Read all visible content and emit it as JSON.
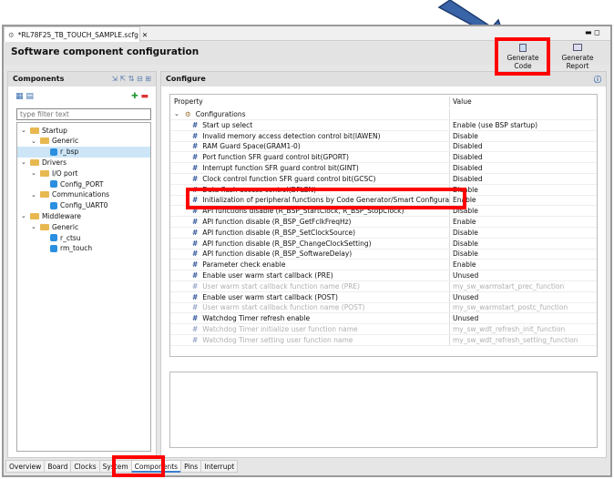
{
  "file_tab": {
    "label": "*RL78F25_TB_TOUCH_SAMPLE.scfg"
  },
  "header": {
    "title": "Software component configuration",
    "generate_code": "Generate Code",
    "generate_report": "Generate Report"
  },
  "components": {
    "title": "Components",
    "filter_placeholder": "type filter text",
    "tree": [
      {
        "label": "Startup",
        "level": 0,
        "type": "folder"
      },
      {
        "label": "Generic",
        "level": 1,
        "type": "folder"
      },
      {
        "label": "r_bsp",
        "level": 2,
        "type": "component",
        "selected": true
      },
      {
        "label": "Drivers",
        "level": 0,
        "type": "folder"
      },
      {
        "label": "I/O port",
        "level": 1,
        "type": "folder"
      },
      {
        "label": "Config_PORT",
        "level": 2,
        "type": "component"
      },
      {
        "label": "Communications",
        "level": 1,
        "type": "folder"
      },
      {
        "label": "Config_UART0",
        "level": 2,
        "type": "component"
      },
      {
        "label": "Middleware",
        "level": 0,
        "type": "folder"
      },
      {
        "label": "Generic",
        "level": 1,
        "type": "folder"
      },
      {
        "label": "r_ctsu",
        "level": 2,
        "type": "component"
      },
      {
        "label": "rm_touch",
        "level": 2,
        "type": "component"
      }
    ]
  },
  "configure": {
    "title": "Configure",
    "col_property": "Property",
    "col_value": "Value",
    "group": "Configurations",
    "rows": [
      {
        "p": "Start up select",
        "v": "Enable (use BSP startup)"
      },
      {
        "p": "Invalid memory access detection control bit(IAWEN)",
        "v": "Disable"
      },
      {
        "p": "RAM Guard Space(GRAM1-0)",
        "v": "Disabled"
      },
      {
        "p": "Port function SFR guard control bit(GPORT)",
        "v": "Disabled"
      },
      {
        "p": "Interrupt function SFR guard control bit(GINT)",
        "v": "Disabled"
      },
      {
        "p": "Clock control function SFR guard control bit(GCSC)",
        "v": "Disabled"
      },
      {
        "p": "Data flash access control(DFLEN)",
        "v": "Disable"
      },
      {
        "p": "Initialization of peripheral functions by Code Generator/Smart Configurator",
        "v": "Enable"
      },
      {
        "p": "API functions disable (R_BSP_StartClock, R_BSP_StopClock)",
        "v": "Disable"
      },
      {
        "p": "API function disable (R_BSP_GetFclkFreqHz)",
        "v": "Enable"
      },
      {
        "p": "API function disable (R_BSP_SetClockSource)",
        "v": "Disable"
      },
      {
        "p": "API function disable (R_BSP_ChangeClockSetting)",
        "v": "Disable"
      },
      {
        "p": "API function disable (R_BSP_SoftwareDelay)",
        "v": "Disable"
      },
      {
        "p": "Parameter check enable",
        "v": "Enable"
      },
      {
        "p": "Enable user warm start callback (PRE)",
        "v": "Unused"
      },
      {
        "p": "User warm start callback  function name (PRE)",
        "v": "my_sw_warmstart_prec_function",
        "disabled": true
      },
      {
        "p": "Enable user warm start callback (POST)",
        "v": "Unused"
      },
      {
        "p": "User warm start callback  function name (POST)",
        "v": "my_sw_warmstart_postc_function",
        "disabled": true
      },
      {
        "p": "Watchdog Timer refresh enable",
        "v": "Unused"
      },
      {
        "p": "Watchdog Timer initialize user function name",
        "v": "my_sw_wdt_refresh_init_function",
        "disabled": true
      },
      {
        "p": "Watchdog Timer setting user function name",
        "v": "my_sw_wdt_refresh_setting_function",
        "disabled": true
      }
    ]
  },
  "bottom_tabs": [
    {
      "label": "Overview"
    },
    {
      "label": "Board"
    },
    {
      "label": "Clocks"
    },
    {
      "label": "System"
    },
    {
      "label": "Components",
      "active": true
    },
    {
      "label": "Pins"
    },
    {
      "label": "Interrupt"
    }
  ],
  "colors": {
    "highlight": "#ff0000",
    "arrow": "#3a64a8"
  }
}
